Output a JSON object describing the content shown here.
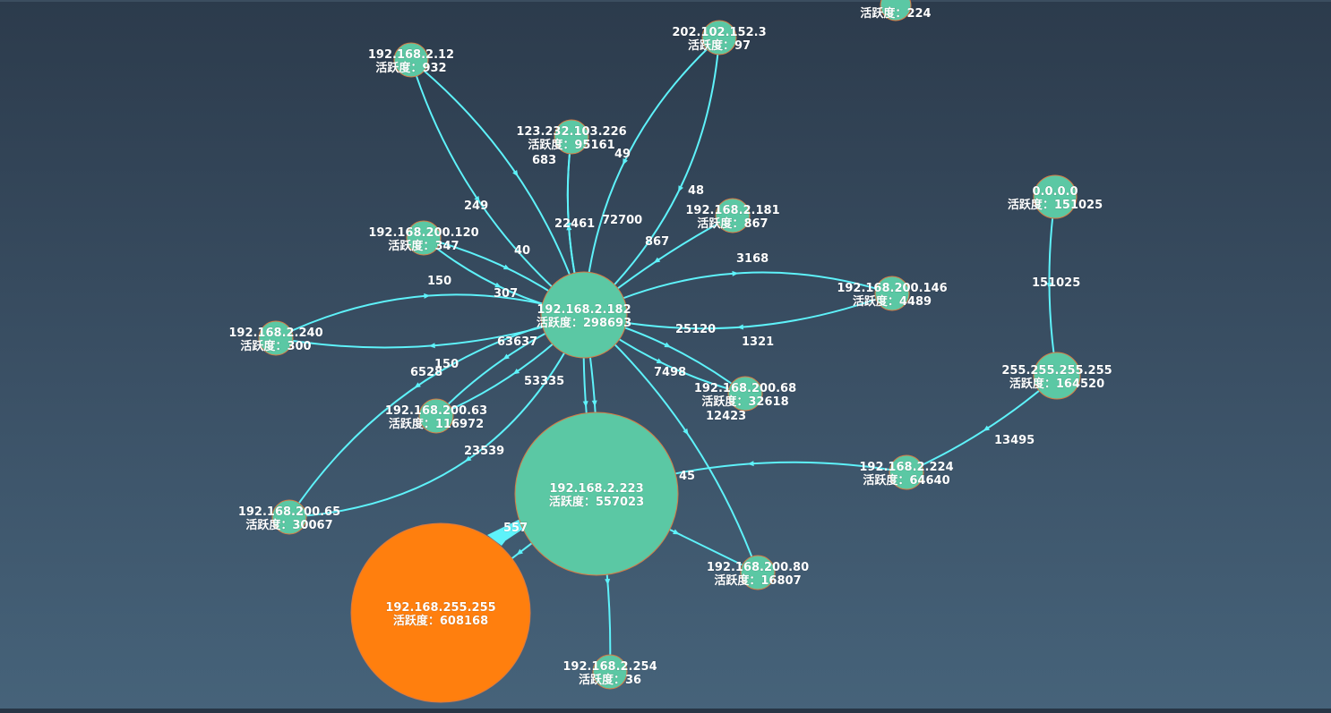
{
  "graph": {
    "node_fill": "#5bc8a4",
    "highlight_fill": "#ff7f0e",
    "edge_color": "#5ef2fa",
    "activity_label": "活跃度：",
    "nodes": [
      {
        "id": "n182",
        "ip": "192.168.2.182",
        "activity": "298693"
      },
      {
        "id": "n223",
        "ip": "192.168.2.223",
        "activity": "557023"
      },
      {
        "id": "n255",
        "ip": "192.168.255.255",
        "activity": "608168",
        "highlight": true
      },
      {
        "id": "n12",
        "ip": "192.168.2.12",
        "activity": "932"
      },
      {
        "id": "n202",
        "ip": "202.102.152.3",
        "activity": "97"
      },
      {
        "id": "ntop",
        "ip": "",
        "activity": "224"
      },
      {
        "id": "n123",
        "ip": "123.232.103.226",
        "activity": "95161"
      },
      {
        "id": "n181",
        "ip": "192.168.2.181",
        "activity": "867"
      },
      {
        "id": "n120",
        "ip": "192.168.200.120",
        "activity": "347"
      },
      {
        "id": "n240",
        "ip": "192.168.2.240",
        "activity": "300"
      },
      {
        "id": "n146",
        "ip": "192.168.200.146",
        "activity": "4489"
      },
      {
        "id": "n0000",
        "ip": "0.0.0.0",
        "activity": "151025"
      },
      {
        "id": "nbcast",
        "ip": "255.255.255.255",
        "activity": "164520"
      },
      {
        "id": "n63",
        "ip": "192.168.200.63",
        "activity": "116972"
      },
      {
        "id": "n68",
        "ip": "192.168.200.68",
        "activity": "32618"
      },
      {
        "id": "n224",
        "ip": "192.168.2.224",
        "activity": "64640"
      },
      {
        "id": "n65",
        "ip": "192.168.200.65",
        "activity": "30067"
      },
      {
        "id": "n80",
        "ip": "192.168.200.80",
        "activity": "16807"
      },
      {
        "id": "n254",
        "ip": "192.168.2.254",
        "activity": "36"
      }
    ],
    "edges": [
      {
        "source": "n12",
        "target": "n182",
        "label": "249"
      },
      {
        "source": "n12",
        "target": "n182",
        "label": "683"
      },
      {
        "source": "n123",
        "target": "n182",
        "label": "22461"
      },
      {
        "source": "n182",
        "target": "n123",
        "label": "72700"
      },
      {
        "source": "n202",
        "target": "n182",
        "label": "49"
      },
      {
        "source": "n202",
        "target": "n182",
        "label": "48"
      },
      {
        "source": "n181",
        "target": "n182",
        "label": "867"
      },
      {
        "source": "n120",
        "target": "n182",
        "label": "40"
      },
      {
        "source": "n120",
        "target": "n182",
        "label": "307"
      },
      {
        "source": "n240",
        "target": "n182",
        "label": "150"
      },
      {
        "source": "n182",
        "target": "n240",
        "label": "6528"
      },
      {
        "source": "n182",
        "target": "n146",
        "label": "3168"
      },
      {
        "source": "n146",
        "target": "n182",
        "label": "1321"
      },
      {
        "source": "n182",
        "target": "n68",
        "label": "25120"
      },
      {
        "source": "n182",
        "target": "n68",
        "label": "7498"
      },
      {
        "source": "n182",
        "target": "n63",
        "label": "63637"
      },
      {
        "source": "n182",
        "target": "n63",
        "label": "53335"
      },
      {
        "source": "n182",
        "target": "n65",
        "label": "150"
      },
      {
        "source": "n182",
        "target": "n65",
        "label": "23539"
      },
      {
        "source": "n182",
        "target": "n80",
        "label": "12423"
      },
      {
        "source": "n182",
        "target": "n223",
        "label": ""
      },
      {
        "source": "n182",
        "target": "n223",
        "label": ""
      },
      {
        "source": "n224",
        "target": "n223",
        "label": "45"
      },
      {
        "source": "nbcast",
        "target": "n224",
        "label": "13495"
      },
      {
        "source": "n0000",
        "target": "nbcast",
        "label": "151025"
      },
      {
        "source": "n223",
        "target": "n255",
        "label": "557"
      },
      {
        "source": "n223",
        "target": "n80",
        "label": ""
      },
      {
        "source": "n223",
        "target": "n254",
        "label": ""
      }
    ]
  }
}
